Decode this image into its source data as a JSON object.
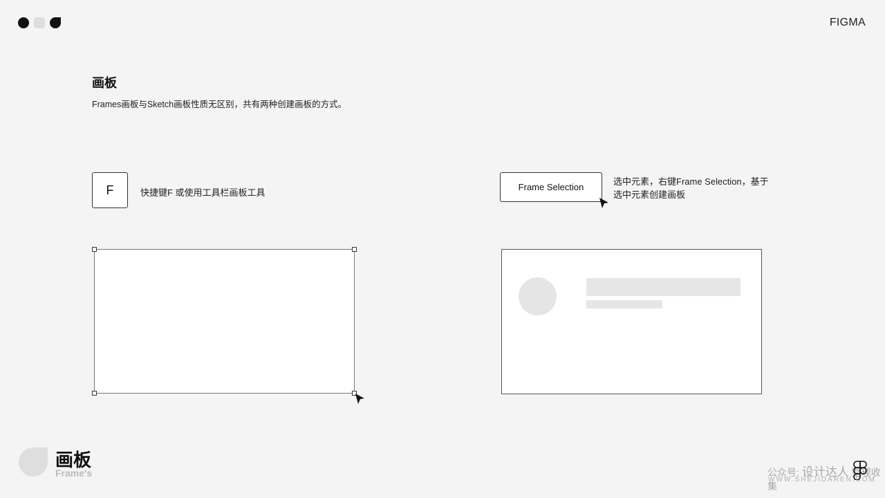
{
  "header": {
    "brand": "FIGMA",
    "logo_icons": [
      "circle-icon",
      "rounded-square-icon",
      "leaf-icon"
    ]
  },
  "section": {
    "title": "画板",
    "description": "Frames画板与Sketch画板性质无区别，共有两种创建画板的方式。"
  },
  "method1": {
    "key_label": "F",
    "text": "快捷键F 或使用工具栏画板工具"
  },
  "method2": {
    "button_label": "Frame Selection",
    "text": "选中元素，右键Frame Selection，基于选中元素创建画板"
  },
  "footer": {
    "title": "画板",
    "subtitle": "Frame's",
    "watermark_prefix": "公众号:",
    "watermark_name": "设计达人",
    "watermark_suffix": "整理收集",
    "watermark_url": "WWW.SHEJIDAREN.COM"
  }
}
